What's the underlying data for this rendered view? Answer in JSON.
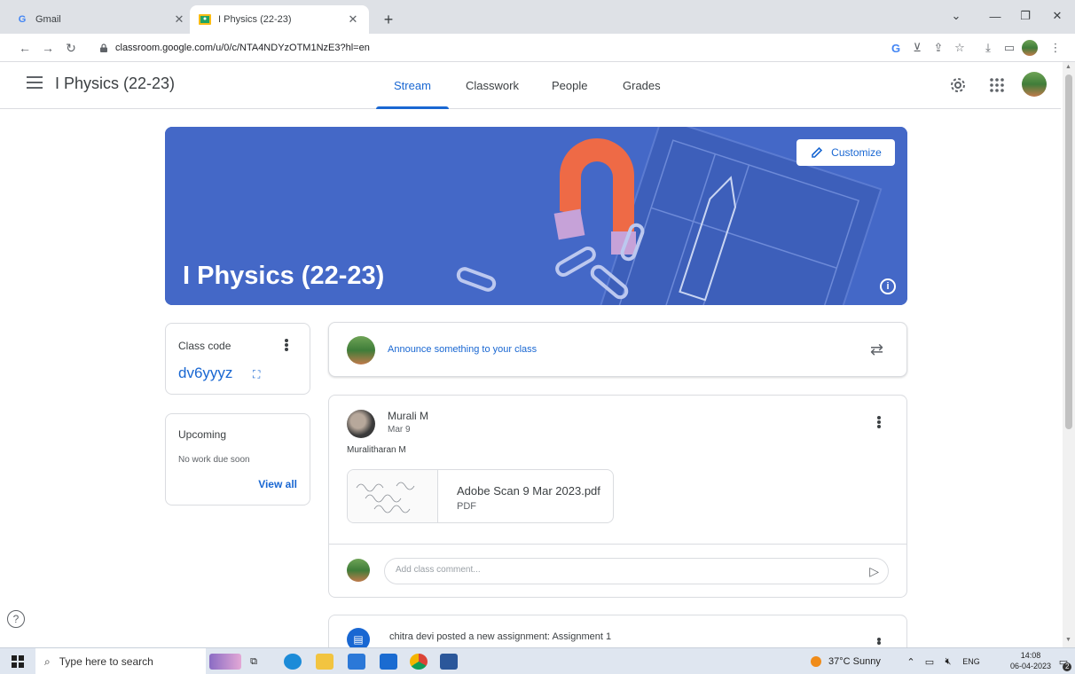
{
  "browser": {
    "tabs": [
      {
        "label": "Gmail",
        "favicon": "G"
      },
      {
        "label": "I Physics (22-23)",
        "favicon": "classroom"
      }
    ],
    "url": "classroom.google.com/u/0/c/NTA4NDYzOTM1NzE3?hl=en"
  },
  "header": {
    "class_name": "I Physics (22-23)",
    "tabs": [
      "Stream",
      "Classwork",
      "People",
      "Grades"
    ],
    "active_tab": "Stream"
  },
  "banner": {
    "title": "I Physics (22-23)",
    "customize_label": "Customize"
  },
  "class_code": {
    "label": "Class code",
    "code": "dv6yyyz"
  },
  "upcoming": {
    "title": "Upcoming",
    "empty_text": "No work due soon",
    "view_all": "View all"
  },
  "announce": {
    "text": "Announce something to your class"
  },
  "post": {
    "author": "Murali M",
    "date": "Mar 9",
    "body": "Muralitharan M",
    "attachment": {
      "name": "Adobe Scan 9 Mar 2023.pdf",
      "type": "PDF"
    },
    "comment_placeholder": "Add class comment..."
  },
  "post2": {
    "text": "chitra devi posted a new assignment: Assignment 1"
  },
  "taskbar": {
    "search_placeholder": "Type here to search",
    "weather": "37°C  Sunny",
    "language": "ENG",
    "time": "14:08",
    "date": "06-04-2023",
    "notifications": "2"
  },
  "colors": {
    "accent": "#1967d2",
    "banner": "#4468c7"
  }
}
